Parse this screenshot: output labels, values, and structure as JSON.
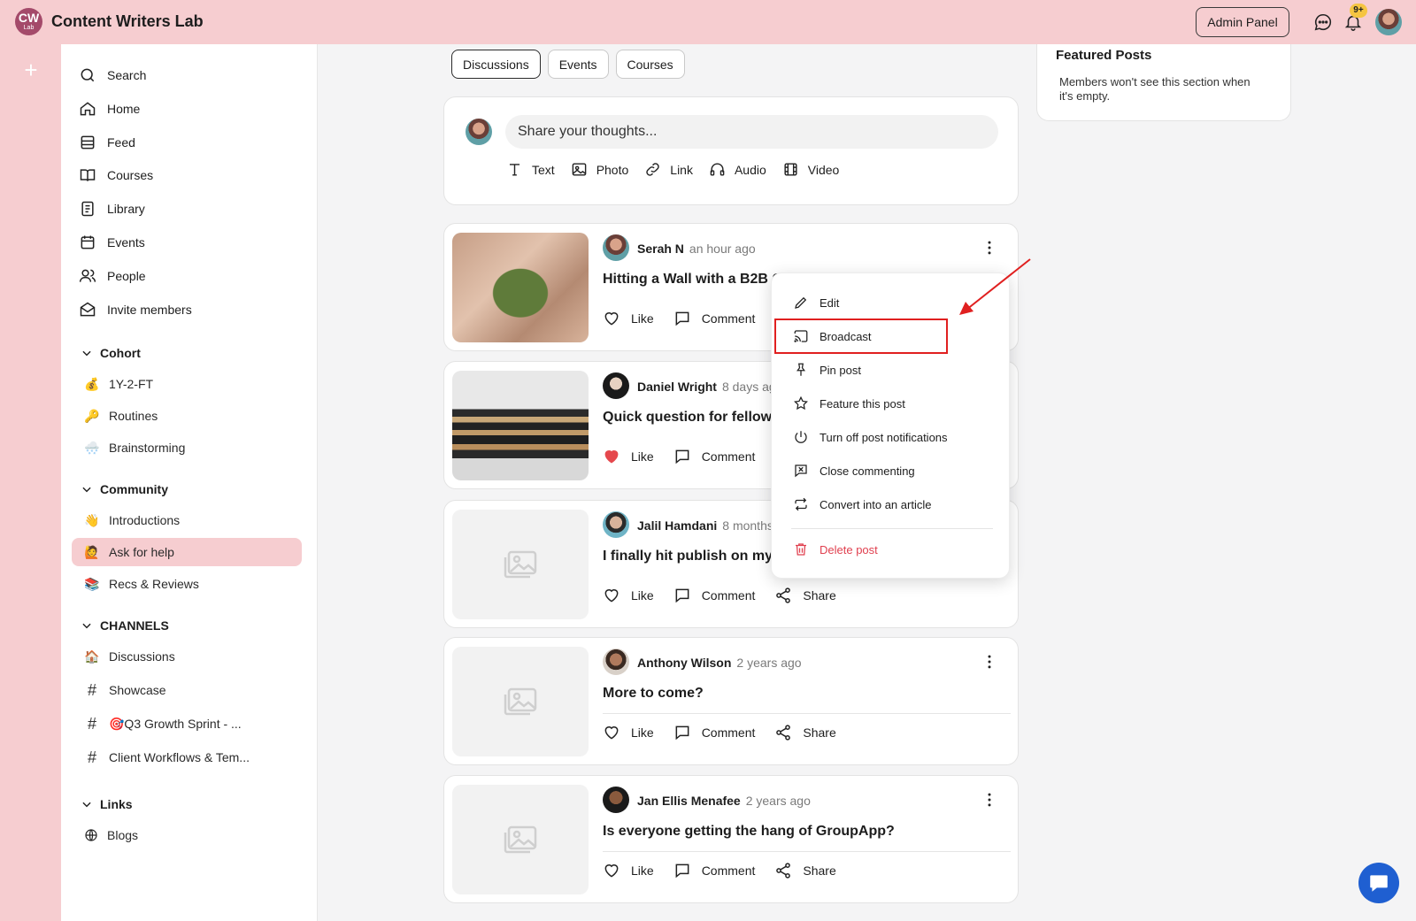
{
  "app": {
    "logo_text": "CW",
    "logo_sub": "Lab",
    "title": "Content Writers Lab",
    "admin_label": "Admin Panel",
    "notification_badge": "9+"
  },
  "nav": {
    "items": [
      {
        "label": "Search",
        "icon": "search-icon"
      },
      {
        "label": "Home",
        "icon": "home-icon"
      },
      {
        "label": "Feed",
        "icon": "feed-icon"
      },
      {
        "label": "Courses",
        "icon": "book-icon"
      },
      {
        "label": "Library",
        "icon": "library-icon"
      },
      {
        "label": "Events",
        "icon": "calendar-icon"
      },
      {
        "label": "People",
        "icon": "people-icon"
      },
      {
        "label": "Invite members",
        "icon": "mail-icon"
      }
    ]
  },
  "sections": {
    "cohort": {
      "title": "Cohort",
      "items": [
        {
          "label": "1Y-2-FT",
          "emoji": "💰"
        },
        {
          "label": "Routines",
          "emoji": "🔑"
        },
        {
          "label": "Brainstorming",
          "emoji": "🌨️"
        }
      ]
    },
    "community": {
      "title": "Community",
      "items": [
        {
          "label": "Introductions",
          "emoji": "👋"
        },
        {
          "label": "Ask for help",
          "emoji": "🙋"
        },
        {
          "label": "Recs & Reviews",
          "emoji": "📚"
        }
      ]
    },
    "channels": {
      "title": "CHANNELS",
      "items": [
        {
          "label": "Discussions",
          "prefix": "🏠"
        },
        {
          "label": "Showcase",
          "prefix": "#"
        },
        {
          "label": "🎯Q3 Growth Sprint - ...",
          "prefix": "#"
        },
        {
          "label": "Client Workflows & Tem...",
          "prefix": "#"
        }
      ]
    },
    "links": {
      "title": "Links",
      "items": [
        {
          "label": "Blogs",
          "icon": "globe-icon"
        }
      ]
    }
  },
  "tabs": [
    {
      "label": "Discussions",
      "active": true
    },
    {
      "label": "Events",
      "active": false
    },
    {
      "label": "Courses",
      "active": false
    }
  ],
  "composer": {
    "placeholder": "Share your thoughts...",
    "tools": [
      "Text",
      "Photo",
      "Link",
      "Audio",
      "Video"
    ]
  },
  "posts": [
    {
      "author": "Serah N",
      "time": "an hour ago",
      "title": "Hitting a Wall with a B2B C",
      "liked": false
    },
    {
      "author": "Daniel Wright",
      "time": "8 days ag",
      "title": "Quick question for fellow",
      "liked": true
    },
    {
      "author": "Jalil Hamdani",
      "time": "8 months",
      "title": "I finally hit publish on my",
      "liked": false
    },
    {
      "author": "Anthony Wilson",
      "time": "2 years ago",
      "title": "More to come?",
      "liked": false
    },
    {
      "author": "Jan Ellis Menafee",
      "time": "2 years ago",
      "title": "Is everyone getting the hang of GroupApp?",
      "liked": false
    }
  ],
  "actions": {
    "like": "Like",
    "comment": "Comment",
    "share": "Share"
  },
  "featured": {
    "title": "Featured Posts",
    "description": "Members won't see this section when it's empty."
  },
  "menu": {
    "items": [
      {
        "label": "Edit",
        "icon": "pencil-icon"
      },
      {
        "label": "Broadcast",
        "icon": "cast-icon"
      },
      {
        "label": "Pin post",
        "icon": "pin-icon"
      },
      {
        "label": "Feature this post",
        "icon": "star-icon"
      },
      {
        "label": "Turn off post notifications",
        "icon": "power-icon"
      },
      {
        "label": "Close commenting",
        "icon": "comment-off-icon"
      },
      {
        "label": "Convert into an article",
        "icon": "convert-icon"
      }
    ],
    "danger": {
      "label": "Delete post",
      "icon": "trash-icon"
    }
  },
  "colors": {
    "brand_pink": "#f6cdd0",
    "logo_bg": "#a44a6a",
    "danger": "#e0404f",
    "highlight": "#e02020",
    "like_red": "#e5484d",
    "chat_blue": "#1f5fd1"
  }
}
